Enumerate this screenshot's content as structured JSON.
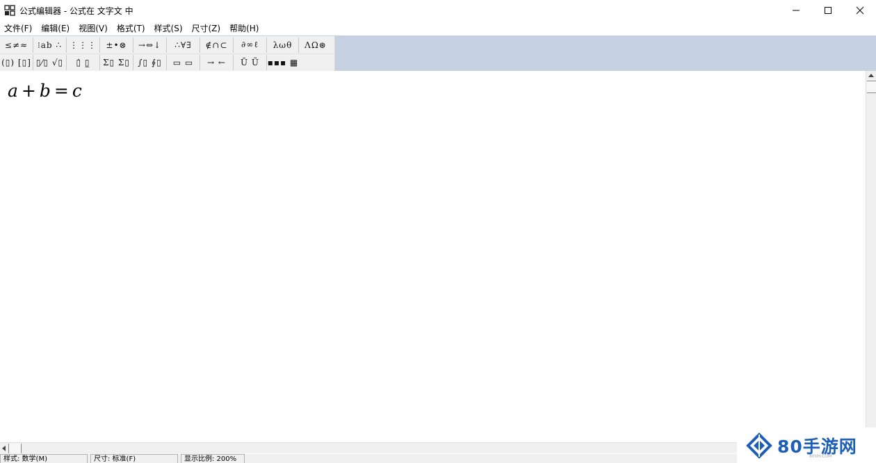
{
  "window": {
    "title": "公式编辑器 - 公式在 文字文 中",
    "controls": {
      "minimize": "minimize-icon",
      "maximize": "maximize-icon",
      "close": "close-icon"
    }
  },
  "menu": [
    "文件(F)",
    "编辑(E)",
    "视图(V)",
    "格式(T)",
    "样式(S)",
    "尺寸(Z)",
    "帮助(H)"
  ],
  "toolbar": {
    "row1": [
      "≤≠≈",
      "⁝ab ∴",
      "⋮⋮⋮",
      "±•⊗",
      "→⇔↓",
      "∴∀∃",
      "∉∩⊂",
      "∂∞ℓ",
      "λωθ",
      "ΛΩ⊛"
    ],
    "row2": [
      "(▯) [▯]",
      "▯⁄▯ √▯",
      "▯̇ ▯̲",
      "Σ▯ Σ▯",
      "∫▯ ∮▯",
      "▭ ▭",
      "→ ←",
      "Ū Ũ",
      "▪▪▪ ▦"
    ]
  },
  "editor": {
    "formula": {
      "a": "a",
      "plus": "+",
      "b": "b",
      "eq": "=",
      "c": "c"
    }
  },
  "status": {
    "style": "样式: 数学(M)",
    "size": "尺寸: 标准(F)",
    "zoom": "显示比例: 200%"
  },
  "watermark": {
    "text": "80手游网",
    "sub": "80VH.COM",
    "color": "#1d5fb5"
  }
}
